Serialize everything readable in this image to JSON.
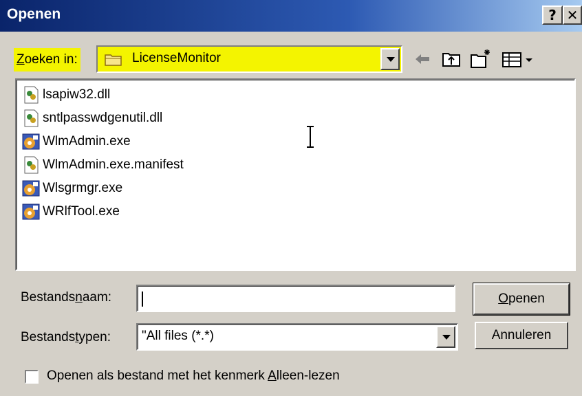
{
  "window": {
    "title": "Openen",
    "help_glyph": "?",
    "close_glyph": "✕"
  },
  "lookin": {
    "label_accel": "Z",
    "label_rest": "oeken in:",
    "value": "LicenseMonitor",
    "highlight_color": "#f4f400"
  },
  "toolbar": {
    "icons": [
      "back-arrow-icon",
      "up-folder-icon",
      "new-folder-icon",
      "view-menu-icon"
    ]
  },
  "files": [
    {
      "name": "lsapiw32.dll",
      "icon": "dll-file-icon"
    },
    {
      "name": "sntlpasswdgenutil.dll",
      "icon": "dll-file-icon"
    },
    {
      "name": "WlmAdmin.exe",
      "icon": "exe-file-icon"
    },
    {
      "name": "WlmAdmin.exe.manifest",
      "icon": "dll-file-icon"
    },
    {
      "name": "Wlsgrmgr.exe",
      "icon": "exe-file-icon"
    },
    {
      "name": "WRlfTool.exe",
      "icon": "exe-file-icon"
    }
  ],
  "filename": {
    "label_pre": "Bestands",
    "label_accel": "n",
    "label_post": "aam:",
    "value": ""
  },
  "filetype": {
    "label_pre": "Bestands",
    "label_accel": "t",
    "label_post": "ypen:",
    "value": "\"All files (*.*)"
  },
  "buttons": {
    "open_accel": "O",
    "open_rest": "penen",
    "cancel": "Annuleren"
  },
  "readonly": {
    "label_pre": "Openen als bestand met het kenmerk ",
    "label_accel": "A",
    "label_post": "lleen-lezen",
    "checked": false
  }
}
